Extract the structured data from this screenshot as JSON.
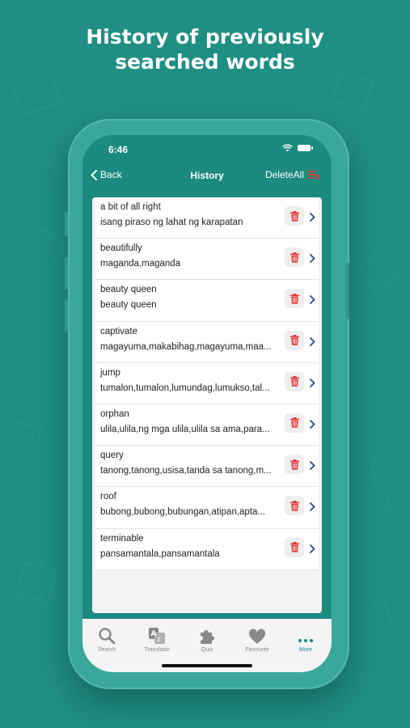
{
  "promo": {
    "title_line1": "History of previously",
    "title_line2": "searched words"
  },
  "status_bar": {
    "time": "6:46"
  },
  "nav": {
    "back_label": "Back",
    "title": "History",
    "delete_all_label": "DeleteAll"
  },
  "history": [
    {
      "word": "a bit of all right",
      "translation": "isang piraso ng lahat ng karapatan"
    },
    {
      "word": "beautifully",
      "translation": "maganda,maganda"
    },
    {
      "word": "beauty queen",
      "translation": "beauty queen"
    },
    {
      "word": "captivate",
      "translation": "magayuma,makabihag,magayuma,maa..."
    },
    {
      "word": "jump",
      "translation": "tumalon,tumalon,lumundag,lumukso,tal..."
    },
    {
      "word": "orphan",
      "translation": "ulila,ulila,ng mga ulila,ulila sa ama,para..."
    },
    {
      "word": "query",
      "translation": "tanong,tanong,usisa,tanda sa tanong,m..."
    },
    {
      "word": "roof",
      "translation": "bubong,bubong,bubungan,atipan,apta..."
    },
    {
      "word": "terminable",
      "translation": "pansamantala,pansamantala"
    }
  ],
  "tabs": [
    {
      "label": "Search",
      "icon": "search-icon",
      "active": false
    },
    {
      "label": "Translator",
      "icon": "translator-icon",
      "active": false
    },
    {
      "label": "Quiz",
      "icon": "puzzle-icon",
      "active": false
    },
    {
      "label": "Favourite",
      "icon": "heart-icon",
      "active": false
    },
    {
      "label": "More",
      "icon": "more-icon",
      "active": true
    }
  ],
  "colors": {
    "background": "#1f8f84",
    "accent": "#1b8a7f",
    "delete_red": "#e53935"
  }
}
